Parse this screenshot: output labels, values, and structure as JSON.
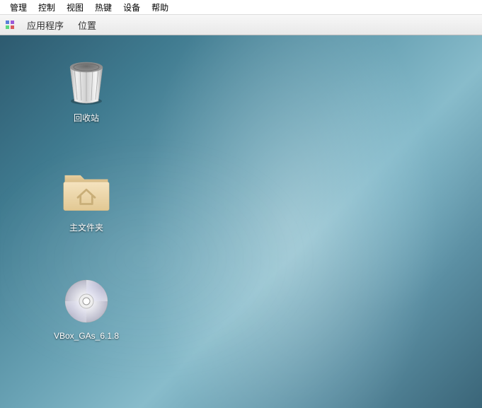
{
  "host_menu": {
    "items": [
      "管理",
      "控制",
      "视图",
      "热键",
      "设备",
      "帮助"
    ]
  },
  "guest_panel": {
    "applications": "应用程序",
    "places": "位置"
  },
  "desktop_icons": {
    "trash": {
      "label": "回收站"
    },
    "home": {
      "label": "主文件夹"
    },
    "disc": {
      "label": "VBox_GAs_6.1.8"
    }
  }
}
